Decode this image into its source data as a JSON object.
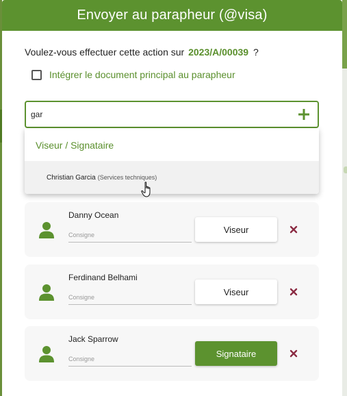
{
  "modal": {
    "title": "Envoyer au parapheur (@visa)"
  },
  "question": {
    "text": "Voulez-vous effectuer cette action sur",
    "reference": "2023/A/00039",
    "mark": "?"
  },
  "checkbox": {
    "label": "Intégrer le document principal au parapheur",
    "checked": false
  },
  "search": {
    "value": "gar",
    "add_icon": "plus-icon"
  },
  "dropdown": {
    "group_label": "Viseur / Signataire",
    "option_name": "Christian Garcia",
    "option_service": "(Services techniques)"
  },
  "workflow": [
    {
      "name": "Danny Ocean",
      "consigne_placeholder": "Consigne",
      "role": "Viseur"
    },
    {
      "name": "Ferdinand Belhami",
      "consigne_placeholder": "Consigne",
      "role": "Viseur"
    },
    {
      "name": "Jack Sparrow",
      "consigne_placeholder": "Consigne",
      "role": "Signataire"
    }
  ],
  "colors": {
    "accent": "#5c922f",
    "delete": "#8b2b43"
  }
}
